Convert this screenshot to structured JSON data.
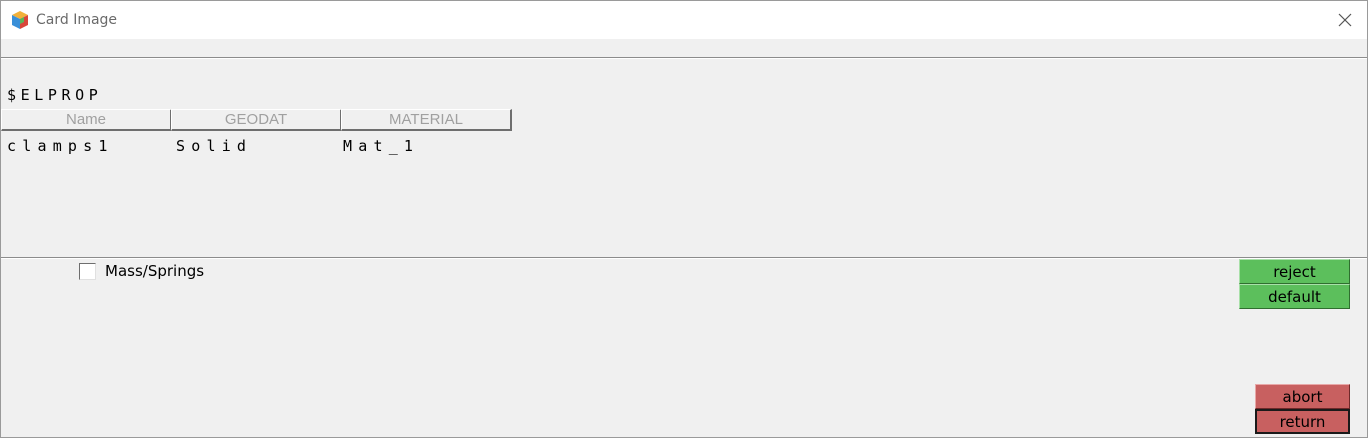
{
  "window": {
    "title": "Card Image",
    "close_icon": "close-icon",
    "app_icon": "cube-icon"
  },
  "card": {
    "header": "$ELPROP",
    "columns": [
      "Name",
      "GEODAT",
      "MATERIAL"
    ],
    "row": [
      "clamps1",
      "Solid",
      "Mat_1"
    ]
  },
  "options": {
    "mass_springs_label": "Mass/Springs",
    "mass_springs_checked": false
  },
  "buttons": {
    "reject": "reject",
    "default": "default",
    "abort": "abort",
    "return": "return"
  },
  "colors": {
    "green_button": "#5cbf5c",
    "red_button": "#c86060"
  }
}
